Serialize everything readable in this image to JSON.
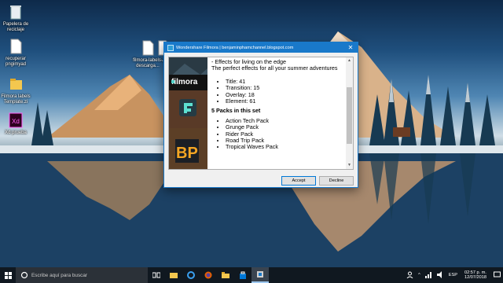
{
  "desktop": {
    "icons": [
      {
        "label": "Papelera de reciclaje",
        "icon": "recycle-bin-icon"
      },
      {
        "label": "recuperar pngimyad",
        "icon": "file-icon"
      },
      {
        "label": "Filmora labels Template.zi",
        "icon": "folder-icon"
      },
      {
        "label": "Xd prueba",
        "icon": "adobe-xd-icon"
      },
      {
        "label": "filmora-labels-descarga...",
        "icon": "file-icon"
      },
      {
        "label": "...",
        "icon": "file-icon"
      }
    ]
  },
  "window": {
    "title": "Wondershare Filmora | benjaminphamchannel.blogspot.com",
    "close_glyph": "✕",
    "banner": {
      "brand_text": "filmora"
    },
    "content": {
      "line1": "- Effects for living on the edge",
      "line2": "The perfect effects for all your summer adventures",
      "stats": [
        "Title: 41",
        "Transition: 15",
        "Overlay: 18",
        "Element: 61"
      ],
      "packs_heading": "5 Packs in this set",
      "packs": [
        "Action Tech Pack",
        "Grunge Pack",
        "Rider Pack",
        "Road Trip Pack",
        "Tropical Waves Pack"
      ]
    },
    "buttons": {
      "accept": "Accept",
      "decline": "Decline"
    }
  },
  "taskbar": {
    "search_placeholder": "Escribe aquí para buscar",
    "apps": [
      "task-view-icon",
      "file-explorer-icon",
      "edge-icon",
      "firefox-icon",
      "folder-icon",
      "store-icon",
      "installer-icon"
    ],
    "tray": {
      "language": "ESP",
      "time": "02:57 p. m.",
      "date": "12/07/2018"
    }
  },
  "colors": {
    "accent": "#1979ca",
    "taskbar": "#101820"
  }
}
